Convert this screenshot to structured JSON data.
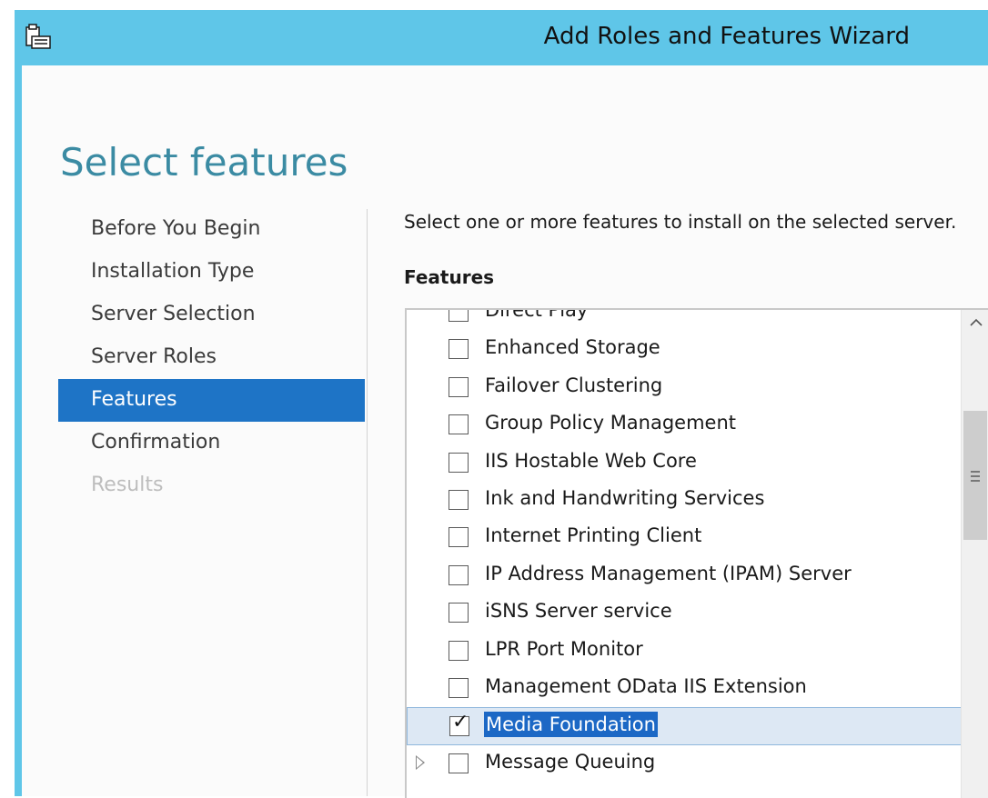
{
  "window": {
    "title": "Add Roles and Features Wizard"
  },
  "page": {
    "title": "Select features"
  },
  "nav": {
    "items": [
      {
        "label": "Before You Begin",
        "state": "normal"
      },
      {
        "label": "Installation Type",
        "state": "normal"
      },
      {
        "label": "Server Selection",
        "state": "normal"
      },
      {
        "label": "Server Roles",
        "state": "normal"
      },
      {
        "label": "Features",
        "state": "active"
      },
      {
        "label": "Confirmation",
        "state": "normal"
      },
      {
        "label": "Results",
        "state": "disabled"
      }
    ]
  },
  "main": {
    "instruction": "Select one or more features to install on the selected server.",
    "features_heading": "Features",
    "features": [
      {
        "label": "Direct Play",
        "checked": false,
        "expandable": false,
        "selected": false
      },
      {
        "label": "Enhanced Storage",
        "checked": false,
        "expandable": false,
        "selected": false
      },
      {
        "label": "Failover Clustering",
        "checked": false,
        "expandable": false,
        "selected": false
      },
      {
        "label": "Group Policy Management",
        "checked": false,
        "expandable": false,
        "selected": false
      },
      {
        "label": "IIS Hostable Web Core",
        "checked": false,
        "expandable": false,
        "selected": false
      },
      {
        "label": "Ink and Handwriting Services",
        "checked": false,
        "expandable": false,
        "selected": false
      },
      {
        "label": "Internet Printing Client",
        "checked": false,
        "expandable": false,
        "selected": false
      },
      {
        "label": "IP Address Management (IPAM) Server",
        "checked": false,
        "expandable": false,
        "selected": false
      },
      {
        "label": "iSNS Server service",
        "checked": false,
        "expandable": false,
        "selected": false
      },
      {
        "label": "LPR Port Monitor",
        "checked": false,
        "expandable": false,
        "selected": false
      },
      {
        "label": "Management OData IIS Extension",
        "checked": false,
        "expandable": false,
        "selected": false
      },
      {
        "label": "Media Foundation",
        "checked": true,
        "expandable": false,
        "selected": true
      },
      {
        "label": "Message Queuing",
        "checked": false,
        "expandable": true,
        "selected": false
      }
    ]
  },
  "icons": {
    "app": "server-manager-wizard-icon",
    "scroll_up": "chevron-up-icon",
    "scroll_grip": "grip-icon",
    "expander": "expand-triangle-icon",
    "check": "checkmark-icon"
  },
  "colors": {
    "title_bar": "#5fc6e8",
    "active_nav": "#1e74c6",
    "page_title": "#3b8ba3",
    "selection": "#1c68c5"
  }
}
